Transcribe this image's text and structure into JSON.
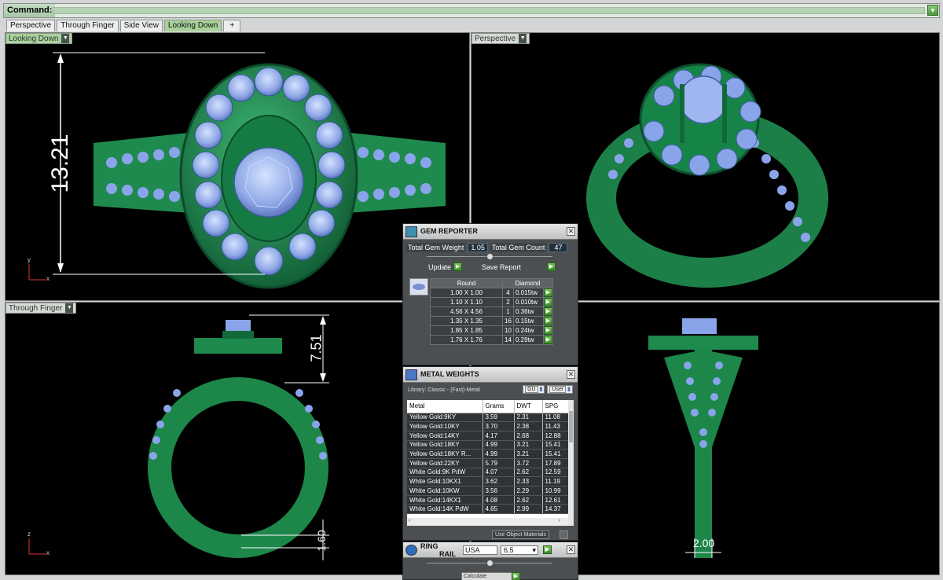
{
  "command_bar": {
    "label": "Command:"
  },
  "tabs": [
    "Perspective",
    "Through Finger",
    "Side View",
    "Looking Down",
    "+"
  ],
  "viewports": {
    "top_left": {
      "label": "Looking Down",
      "dimension": "13.21",
      "axis": [
        "y",
        "x"
      ]
    },
    "top_right": {
      "label": "Perspective"
    },
    "bottom_left": {
      "label": "Through Finger",
      "dimension_top": "7.51",
      "dimension_bottom": "1.60",
      "axis": [
        "z",
        "x"
      ]
    },
    "bottom_right": {
      "dimension": "2.00"
    }
  },
  "gem_reporter": {
    "title": "GEM REPORTER",
    "total_weight_label": "Total Gem Weight",
    "total_weight_value": "1.05",
    "total_count_label": "Total Gem Count",
    "total_count_value": "47",
    "update_label": "Update",
    "save_label": "Save Report",
    "col_shape": "Round",
    "col_type": "Diamond",
    "rows": [
      {
        "size": "1.00 X 1.00",
        "count": "4",
        "wt": "0.015tw"
      },
      {
        "size": "1.10 X 1.10",
        "count": "2",
        "wt": "0.010tw"
      },
      {
        "size": "4.56 X 4.56",
        "count": "1",
        "wt": "0.36tw"
      },
      {
        "size": "1.35 X 1.35",
        "count": "16",
        "wt": "0.15tw"
      },
      {
        "size": "1.85 X 1.85",
        "count": "10",
        "wt": "0.24tw"
      },
      {
        "size": "1.76 X 1.76",
        "count": "14",
        "wt": "0.29tw"
      }
    ]
  },
  "metal_weights": {
    "title": "METAL WEIGHTS",
    "library": "Library: Classic - (Fast)-Metal",
    "btn_gu": "GU",
    "btn_user": "User",
    "headers": [
      "Metal",
      "Grams",
      "DWT",
      "SPG"
    ],
    "rows": [
      [
        "Yellow Gold:9KY",
        "3.59",
        "2.31",
        "11.08"
      ],
      [
        "Yellow Gold:10KY",
        "3.70",
        "2.38",
        "11.43"
      ],
      [
        "Yellow Gold:14KY",
        "4.17",
        "2.68",
        "12.88"
      ],
      [
        "Yellow Gold:18KY",
        "4.99",
        "3.21",
        "15.41"
      ],
      [
        "Yellow Gold:18KY R...",
        "4.99",
        "3.21",
        "15.41"
      ],
      [
        "Yellow Gold:22KY",
        "5.79",
        "3.72",
        "17.89"
      ],
      [
        "White Gold:9K PdW",
        "4.07",
        "2.62",
        "12.59"
      ],
      [
        "White Gold:10KX1",
        "3.62",
        "2.33",
        "11.19"
      ],
      [
        "White Gold:10KW",
        "3.56",
        "2.29",
        "10.99"
      ],
      [
        "White Gold:14KX1",
        "4.08",
        "2.62",
        "12.61"
      ],
      [
        "White Gold:14K PdW",
        "4.65",
        "2.99",
        "14.37"
      ]
    ],
    "use_object_materials": "Use Object Materials"
  },
  "ring_rail": {
    "title_1": "RING",
    "title_2": "RAIL",
    "region": "USA",
    "size": "6.5",
    "calculate_label": "Calculate"
  }
}
